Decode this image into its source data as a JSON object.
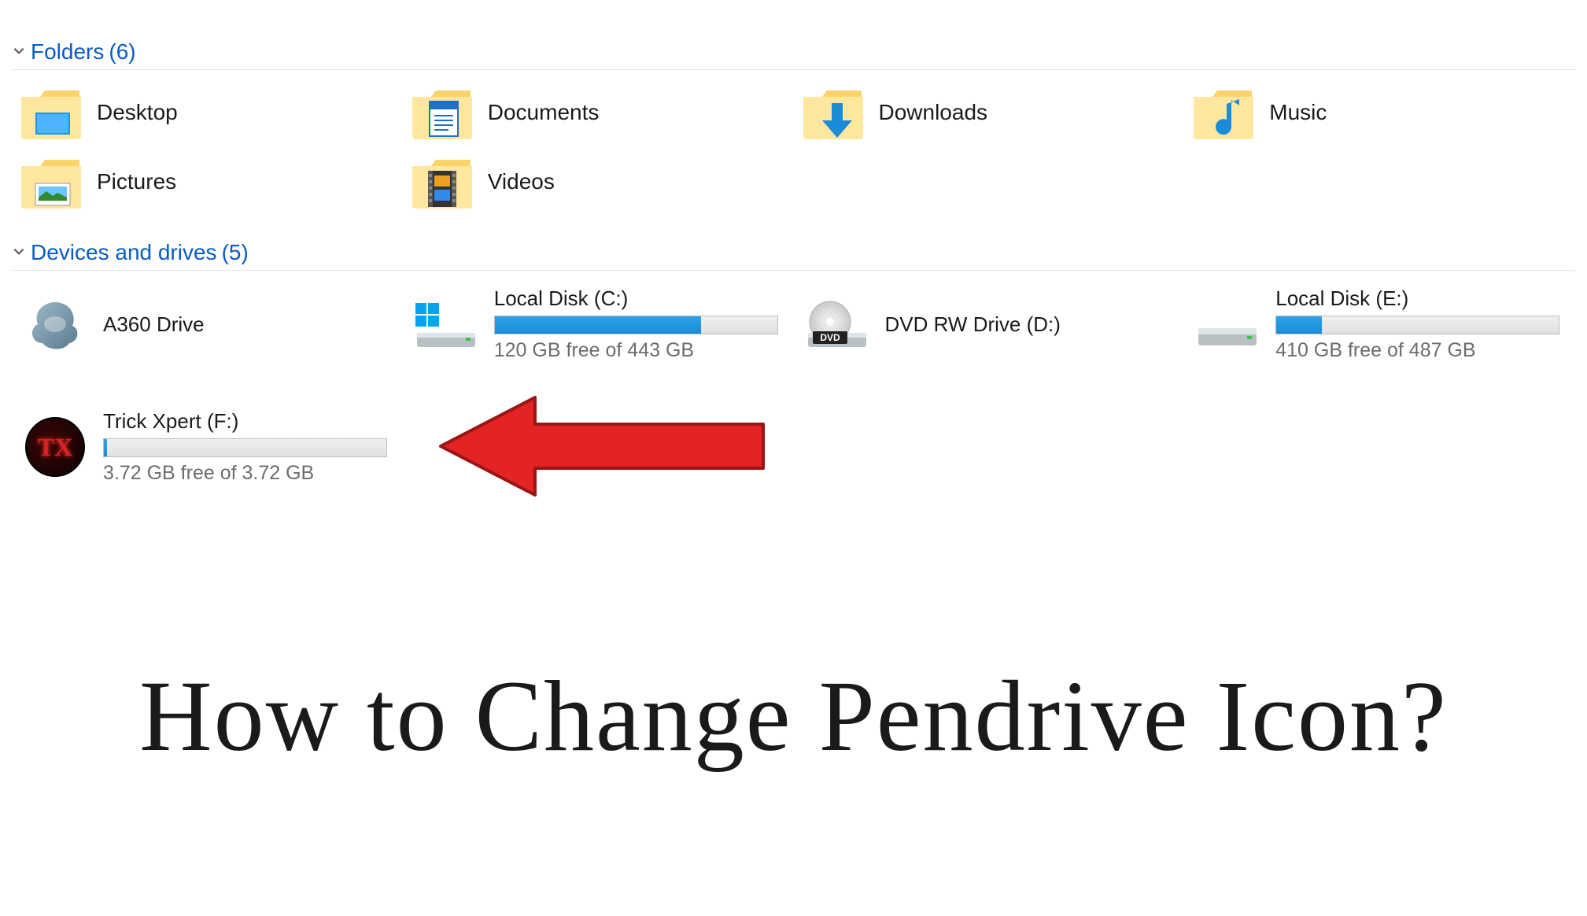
{
  "sections": {
    "folders": {
      "title": "Folders",
      "count": "(6)"
    },
    "drives": {
      "title": "Devices and drives",
      "count": "(5)"
    }
  },
  "folders": [
    {
      "name": "Desktop"
    },
    {
      "name": "Documents"
    },
    {
      "name": "Downloads"
    },
    {
      "name": "Music"
    },
    {
      "name": "Pictures"
    },
    {
      "name": "Videos"
    }
  ],
  "drives": [
    {
      "name": "A360 Drive",
      "free": "",
      "fill": 0
    },
    {
      "name": "Local Disk (C:)",
      "free": "120 GB free of 443 GB",
      "fill": 73
    },
    {
      "name": "DVD RW Drive (D:)",
      "free": "",
      "fill": 0
    },
    {
      "name": "Local Disk (E:)",
      "free": "410 GB free of 487 GB",
      "fill": 16
    },
    {
      "name": "Trick Xpert (F:)",
      "free": "3.72 GB free of 3.72 GB",
      "fill": 1
    }
  ],
  "caption": "How to Change Pendrive Icon?"
}
